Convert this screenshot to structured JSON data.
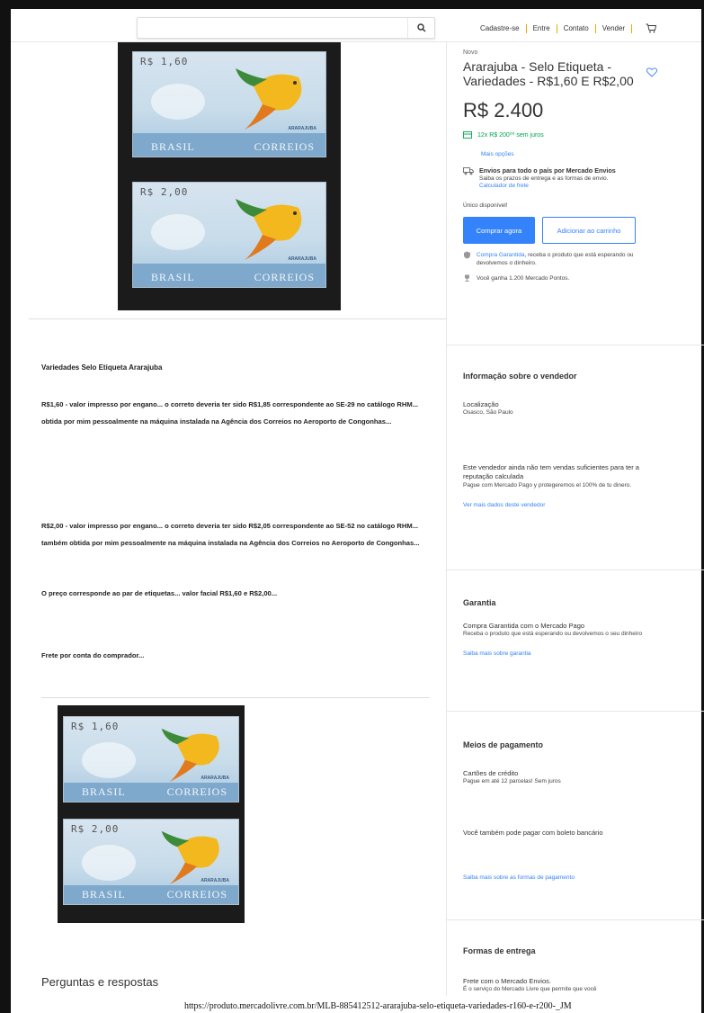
{
  "header": {
    "search_placeholder": "",
    "nav": [
      "Cadastre-se",
      "Entre",
      "Contato",
      "Vender"
    ]
  },
  "product": {
    "condition": "Novo",
    "title": "Ararajuba - Selo Etiqueta - Variedades - R$1,60 E R$2,00",
    "price": "R$ 2.400",
    "installments": "12x R$ 200⁰⁰ sem juros",
    "more_options": "Mais opções",
    "shipping_title": "Envios para todo o país por Mercado Envios",
    "shipping_sub": "Saiba os prazos de entrega e as formas de envio.",
    "shipping_calc": "Calculador de frete",
    "availability": "Único disponível!",
    "buy_label": "Comprar agora",
    "cart_label": "Adicionar ao carrinho",
    "guarantee_link": "Compra Garantida",
    "guarantee_text": ", receba o produto que está esperando ou devolvemos o dinheiro.",
    "points": "Você ganha 1.200 Mercado Pontos."
  },
  "stamps": {
    "top_value": "R$ 1,60",
    "bottom_value": "R$ 2,00",
    "country": "BRASIL",
    "post": "CORREIOS",
    "bird": "ARARAJUBA"
  },
  "description": {
    "title": "Variedades Selo Etiqueta Ararajuba",
    "p1": "R$1,60 - valor impresso por engano... o correto deveria ter sido R$1,85 correspondente ao SE-29 no catálogo RHM... obtida por mim pessoalmente na máquina instalada na Agência dos Correios no Aeroporto de Congonhas...",
    "p2": "R$2,00 - valor impresso por engano... o correto deveria ter sido R$2,05 correspondente ao SE-52 no catálogo RHM... também obtida por mim pessoalmente na máquina instalada na Agência dos Correios no Aeroporto de Congonhas...",
    "p3": "O preço corresponde ao par de etiquetas... valor facial R$1,60 e R$2,00...",
    "p4": "Frete por conta do comprador..."
  },
  "qa_title": "Perguntas e respostas",
  "seller": {
    "title": "Informação sobre o vendedor",
    "location_label": "Localização",
    "location": "Osasco, São Paulo",
    "reputation": "Este vendedor ainda não tem vendas suficientes para ter a reputação calculada",
    "protect": "Pague com Mercado Pago y protegeremos el 100% de tu dinero.",
    "more_link": "Ver mais dados deste vendedor"
  },
  "warranty": {
    "title": "Garantia",
    "line": "Compra Garantida com o Mercado Pago",
    "sub": "Receba o produto que está esperando ou devolvemos o seu dinheiro",
    "link": "Saiba mais sobre garantia"
  },
  "payment": {
    "title": "Meios de pagamento",
    "cards": "Cartões de crédito",
    "cards_sub": "Pague em até 12 parcelas! Sem juros",
    "boleto": "Você também pode pagar com boleto bancário",
    "link": "Saiba mais sobre as formas de pagamento"
  },
  "delivery": {
    "title": "Formas de entrega",
    "line": "Frete com o Mercado Envios.",
    "sub": "É o serviço do Mercado Livre que permite que você"
  },
  "footer_url": "https://produto.mercadolivre.com.br/MLB-885412512-ararajuba-selo-etiqueta-variedades-r160-e-r200-_JM",
  "colors": {
    "accent": "#3483fa",
    "green": "#00a650"
  }
}
